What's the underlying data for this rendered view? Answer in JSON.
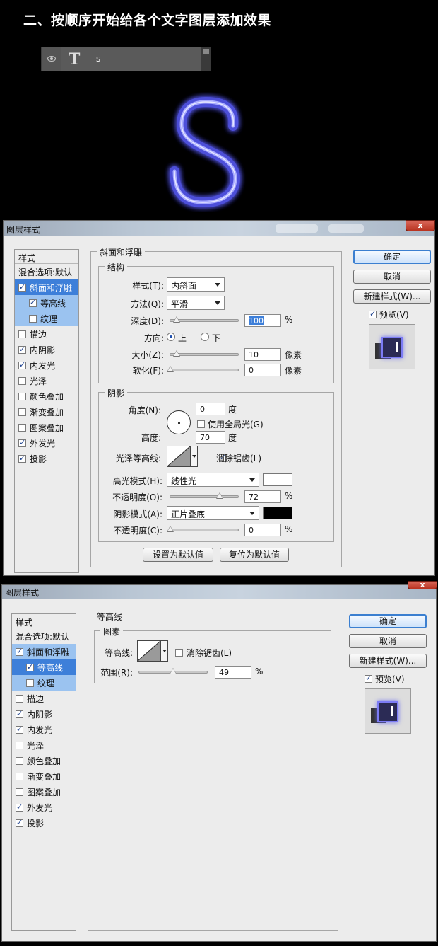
{
  "heading": "二、按顺序开始给各个文字图层添加效果",
  "layer": {
    "name": "s",
    "type_glyph": "T"
  },
  "canvas_text": "S",
  "dialog1": {
    "title": "图层样式",
    "close": "x",
    "styles_header": "样式",
    "blend_options": "混合选项:默认",
    "styles": [
      {
        "label": "斜面和浮雕",
        "checked": true
      },
      {
        "label": "等高线",
        "checked": true
      },
      {
        "label": "纹理",
        "checked": false
      },
      {
        "label": "描边",
        "checked": false
      },
      {
        "label": "内阴影",
        "checked": true
      },
      {
        "label": "内发光",
        "checked": true
      },
      {
        "label": "光泽",
        "checked": false
      },
      {
        "label": "颜色叠加",
        "checked": false
      },
      {
        "label": "渐变叠加",
        "checked": false
      },
      {
        "label": "图案叠加",
        "checked": false
      },
      {
        "label": "外发光",
        "checked": true
      },
      {
        "label": "投影",
        "checked": true
      }
    ],
    "section_title": "斜面和浮雕",
    "structure": {
      "legend": "结构",
      "style_label": "样式(T):",
      "style_value": "内斜面",
      "technique_label": "方法(Q):",
      "technique_value": "平滑",
      "depth_label": "深度(D):",
      "depth_value": "100",
      "percent": "%",
      "direction_label": "方向:",
      "dir_up": "上",
      "dir_down": "下",
      "size_label": "大小(Z):",
      "size_value": "10",
      "px": "像素",
      "soften_label": "软化(F):",
      "soften_value": "0",
      "px2": "像素"
    },
    "shading": {
      "legend": "阴影",
      "angle_label": "角度(N):",
      "angle_value": "0",
      "deg": "度",
      "global_light": "使用全局光(G)",
      "altitude_label": "高度:",
      "altitude_value": "70",
      "deg2": "度",
      "gloss_label": "光泽等高线:",
      "antialias": "消除锯齿(L)",
      "highlight_label": "高光模式(H):",
      "highlight_value": "线性光",
      "highlight_color": "#ffffff",
      "hopacity_label": "不透明度(O):",
      "hopacity_value": "72",
      "percent": "%",
      "shadow_label": "阴影模式(A):",
      "shadow_value": "正片叠底",
      "shadow_color": "#000000",
      "sopacity_label": "不透明度(C):",
      "sopacity_value": "0",
      "percent2": "%"
    },
    "make_default": "设置为默认值",
    "reset_default": "复位为默认值",
    "ok": "确定",
    "cancel": "取消",
    "new_style": "新建样式(W)...",
    "preview": "预览(V)"
  },
  "dialog2": {
    "title": "图层样式",
    "close": "x",
    "styles_header": "样式",
    "blend_options": "混合选项:默认",
    "styles": [
      {
        "label": "斜面和浮雕",
        "checked": true
      },
      {
        "label": "等高线",
        "checked": true
      },
      {
        "label": "纹理",
        "checked": false
      },
      {
        "label": "描边",
        "checked": false
      },
      {
        "label": "内阴影",
        "checked": true
      },
      {
        "label": "内发光",
        "checked": true
      },
      {
        "label": "光泽",
        "checked": false
      },
      {
        "label": "颜色叠加",
        "checked": false
      },
      {
        "label": "渐变叠加",
        "checked": false
      },
      {
        "label": "图案叠加",
        "checked": false
      },
      {
        "label": "外发光",
        "checked": true
      },
      {
        "label": "投影",
        "checked": true
      }
    ],
    "section_title": "等高线",
    "elements_legend": "图素",
    "contour_label": "等高线:",
    "antialias": "消除锯齿(L)",
    "range_label": "范围(R):",
    "range_value": "49",
    "percent": "%",
    "ok": "确定",
    "cancel": "取消",
    "new_style": "新建样式(W)...",
    "preview": "预览(V)"
  },
  "colors": {
    "glow": "#6a6cf0",
    "accent": "#3d7fd9"
  }
}
